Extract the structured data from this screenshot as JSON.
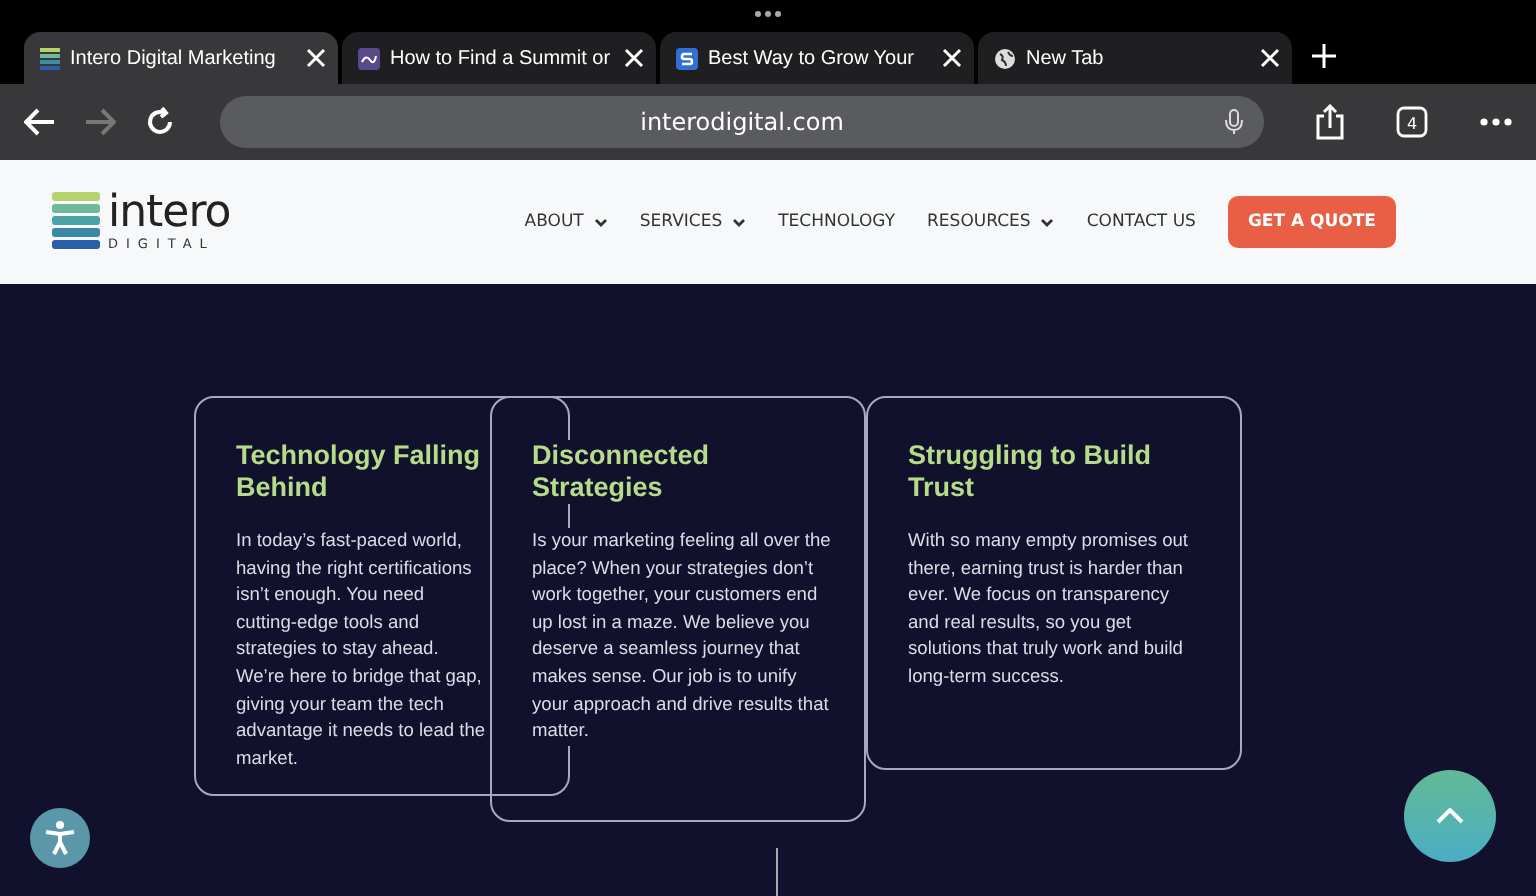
{
  "browser": {
    "tabs": [
      {
        "title": "Intero Digital Marketing",
        "selected": true,
        "kind": "bars"
      },
      {
        "title": "How to Find a Summit or",
        "selected": false,
        "kind": "wave"
      },
      {
        "title": "Best Way to Grow Your",
        "selected": false,
        "kind": "s"
      },
      {
        "title": "New Tab",
        "selected": false,
        "kind": "globe"
      }
    ],
    "address": "interodigital.com",
    "tab_count": "4"
  },
  "site": {
    "logo": {
      "name": "intero",
      "sub": "DIGITAL"
    },
    "nav": [
      {
        "label": "ABOUT",
        "dropdown": true
      },
      {
        "label": "SERVICES",
        "dropdown": true
      },
      {
        "label": "TECHNOLOGY",
        "dropdown": false
      },
      {
        "label": "RESOURCES",
        "dropdown": true
      },
      {
        "label": "CONTACT US",
        "dropdown": false
      }
    ],
    "cta": "GET A QUOTE",
    "cards": [
      {
        "title": "Technology Falling Behind",
        "body": "In today’s fast-paced world, having the right certifications isn’t enough. You need cutting-edge tools and strategies to stay ahead. We’re here to bridge that gap, giving your team the tech advantage it needs to lead the market."
      },
      {
        "title": "Disconnected Strategies",
        "body": "Is your marketing feeling all over the place? When your strategies don’t work together, your customers end up lost in a maze. We believe you deserve a seamless journey that makes sense. Our job is to unify your approach and drive results that matter."
      },
      {
        "title": "Struggling to Build Trust",
        "body": "With so many empty promises out there, earning trust is harder than ever. We focus on transparency and real results, so you get solutions that truly work and build long-term success."
      }
    ]
  }
}
